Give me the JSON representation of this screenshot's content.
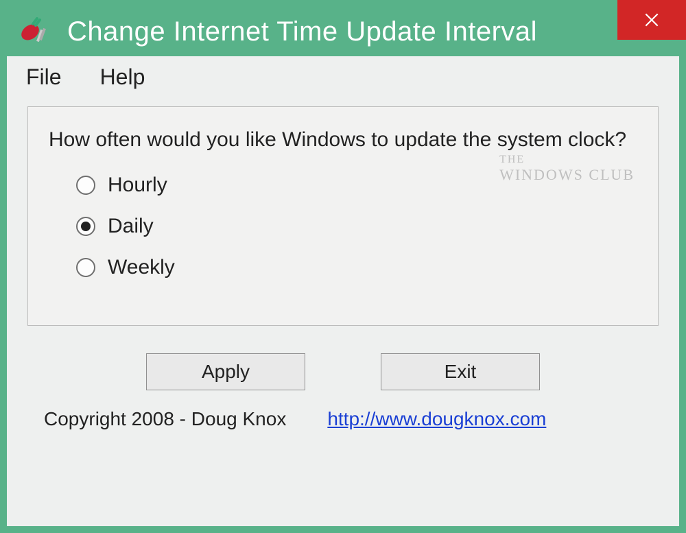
{
  "window": {
    "title": "Change Internet Time Update Interval"
  },
  "menu": {
    "file": "File",
    "help": "Help"
  },
  "main": {
    "prompt": "How often would you like Windows to update the system clock?",
    "options": {
      "hourly": "Hourly",
      "daily": "Daily",
      "weekly": "Weekly"
    },
    "selected": "daily",
    "watermark_line1": "THE",
    "watermark_line2": "WINDOWS CLUB"
  },
  "buttons": {
    "apply": "Apply",
    "exit": "Exit"
  },
  "footer": {
    "copyright": "Copyright 2008 - Doug Knox",
    "link_text": "http://www.dougknox.com"
  }
}
